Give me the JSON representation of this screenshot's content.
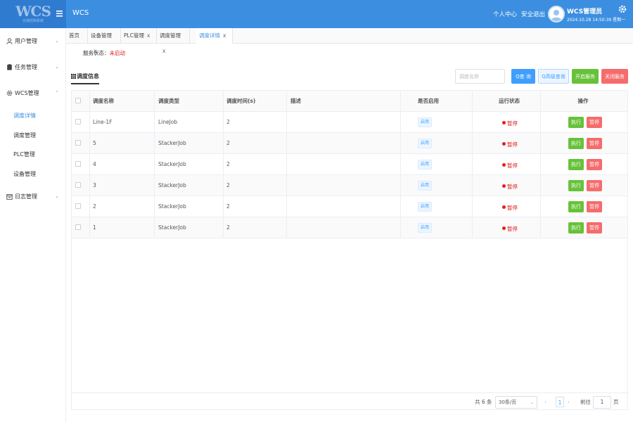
{
  "brand": {
    "logo_text": "WCS",
    "logo_sub": "仓储控制系统",
    "app_title": "WCS"
  },
  "header": {
    "links": [
      "个人中心",
      "安全退出"
    ],
    "user_name": "WCS管理员",
    "datetime": "2024.10.28 14:50:39 星期一",
    "icons": [
      "menu-toggle-icon",
      "avatar-icon",
      "gear-icon"
    ]
  },
  "sidebar": {
    "groups": [
      {
        "label": "用户管理",
        "icon": "user-icon"
      },
      {
        "label": "任务管理",
        "icon": "clipboard-icon"
      },
      {
        "label": "WCS管理",
        "icon": "gear-icon"
      },
      {
        "label": "日志管理",
        "icon": "calendar-icon"
      }
    ],
    "sub_items": [
      "调度详情",
      "调度管理",
      "PLC管理",
      "设备管理"
    ]
  },
  "tabs": [
    {
      "label": "首页",
      "closable": false
    },
    {
      "label": "设备管理",
      "closable": true
    },
    {
      "label": "PLC管理",
      "closable": true
    },
    {
      "label": "调度管理",
      "closable": true
    },
    {
      "label": "调度详情",
      "closable": true
    }
  ],
  "status": {
    "label": "服务状态：",
    "value": "未启动"
  },
  "toolbar": {
    "section_title": "调度信息",
    "search_placeholder": "调度名称",
    "query_label": "Q查 询",
    "advanced_query_label": "Q高级查询",
    "start_label": "开启服务",
    "stop_label": "关闭服务"
  },
  "table": {
    "headers": [
      "调度名称",
      "调度类型",
      "调度时间(s)",
      "描述",
      "是否启用",
      "运行状态",
      "操作"
    ],
    "rows": [
      {
        "name": "Line-1F",
        "type": "LineJob",
        "time": "2",
        "desc": "",
        "enabled": "启用",
        "state": "暂停"
      },
      {
        "name": "5",
        "type": "StackerJob",
        "time": "2",
        "desc": "",
        "enabled": "启用",
        "state": "暂停"
      },
      {
        "name": "4",
        "type": "StackerJob",
        "time": "2",
        "desc": "",
        "enabled": "启用",
        "state": "暂停"
      },
      {
        "name": "3",
        "type": "StackerJob",
        "time": "2",
        "desc": "",
        "enabled": "启用",
        "state": "暂停"
      },
      {
        "name": "2",
        "type": "StackerJob",
        "time": "2",
        "desc": "",
        "enabled": "启用",
        "state": "暂停"
      },
      {
        "name": "1",
        "type": "StackerJob",
        "time": "2",
        "desc": "",
        "enabled": "启用",
        "state": "暂停"
      }
    ],
    "action_labels": {
      "run": "执行",
      "pause": "暂停"
    }
  },
  "pagination": {
    "total": "共 6 条",
    "page_size": "30条/页",
    "current_page": "1",
    "goto_label": "前往",
    "goto_value": "1",
    "page_suffix": "页"
  },
  "colors": {
    "primary": "#3c8fe0",
    "success": "#67c23a",
    "danger": "#f56c6c",
    "status_red": "#e02020"
  }
}
